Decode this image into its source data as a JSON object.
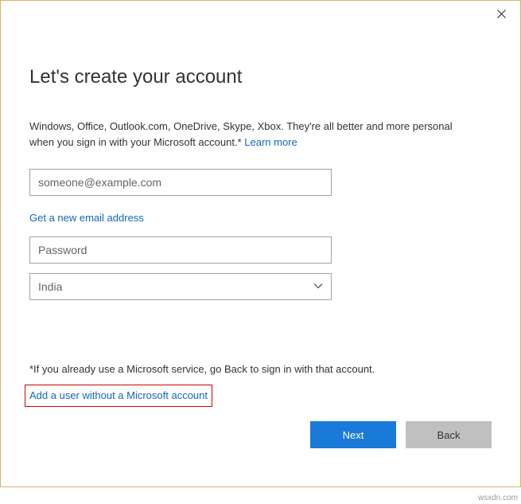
{
  "title": "Let's create your account",
  "description_prefix": "Windows, Office, Outlook.com, OneDrive, Skype, Xbox. They're all better and more personal when you sign in with your Microsoft account.* ",
  "learn_more": "Learn more",
  "email": {
    "placeholder": "someone@example.com",
    "value": ""
  },
  "new_email_link": "Get a new email address",
  "password": {
    "placeholder": "Password",
    "value": ""
  },
  "country": {
    "value": "India"
  },
  "footnote": "*If you already use a Microsoft service, go Back to sign in with that account.",
  "add_without_ms": "Add a user without a Microsoft account",
  "buttons": {
    "next": "Next",
    "back": "Back"
  },
  "watermark": "wsxdn.com"
}
